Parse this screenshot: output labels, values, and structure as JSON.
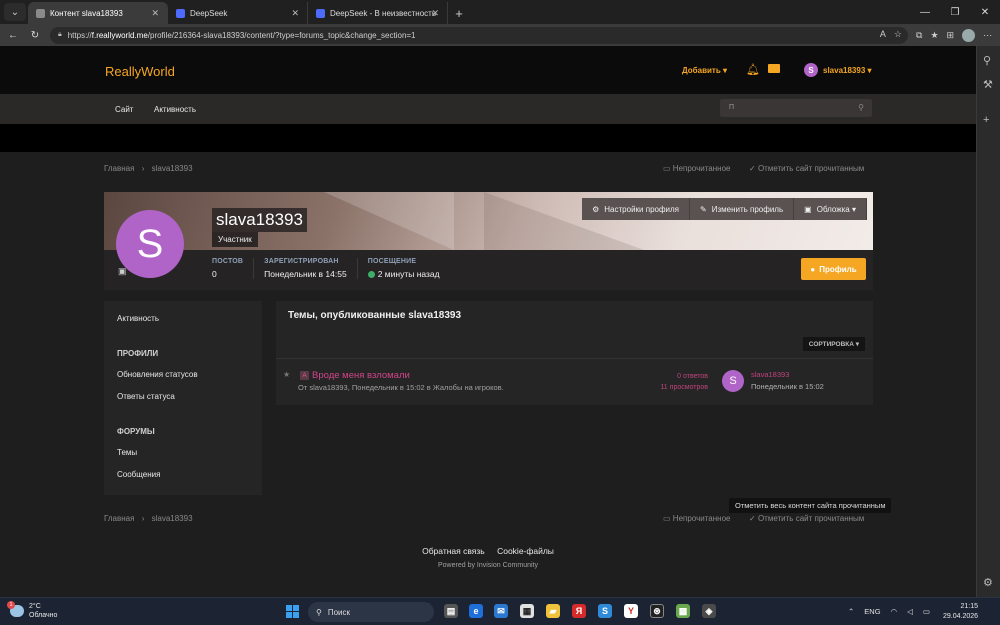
{
  "browser": {
    "tabs": [
      {
        "label": "Контент slava18393",
        "active": true
      },
      {
        "label": "DeepSeek",
        "active": false
      },
      {
        "label": "DeepSeek - В неизвестность",
        "active": false
      }
    ],
    "url_prefix": "https://",
    "url_host": "f.reallyworld.me",
    "url_path": "/profile/216364-slava18393/content/?type=forums_topic&change_section=1"
  },
  "site": {
    "logo": "ReallyWorld",
    "add_label": "Добавить ▾",
    "user_initial": "S",
    "user_name": "slava18393 ▾",
    "nav": [
      "Сайт",
      "Активность"
    ],
    "search_placeholder": "П"
  },
  "breadcrumb": {
    "home": "Главная",
    "sep": "›",
    "current": "slava18393",
    "unread": "Непрочитанное",
    "mark_read": "Отметить сайт прочитанным"
  },
  "profile": {
    "initial": "S",
    "name": "slava18393",
    "role": "Участник",
    "buttons": {
      "settings": "Настройки профиля",
      "edit": "Изменить профиль",
      "cover": "Обложка ▾"
    },
    "stats": {
      "posts_label": "ПОСТОВ",
      "posts_value": "0",
      "registered_label": "ЗАРЕГИСТРИРОВАН",
      "registered_value": "Понедельник в 14:55",
      "visit_label": "ПОСЕЩЕНИЕ",
      "visit_value": "2 минуты назад"
    },
    "profile_button": "Профиль"
  },
  "sidebar": {
    "activity": "Активность",
    "profiles_head": "ПРОФИЛИ",
    "status_updates": "Обновления статусов",
    "status_replies": "Ответы статуса",
    "forums_head": "ФОРУМЫ",
    "topics": "Темы",
    "messages": "Сообщения"
  },
  "main": {
    "title": "Темы, опубликованные slava18393",
    "sort": "СОРТИРОВКА ▾",
    "topic": {
      "badge": "A",
      "title": "Вроде меня взломали",
      "meta": "От slava18393, Понедельник в 15:02 в Жалобы на игроков.",
      "replies": "0 ответов",
      "views": "11 просмотров",
      "last_initial": "S",
      "last_user": "slava18393",
      "last_date": "Понедельник в 15:02"
    }
  },
  "tooltip": "Отметить весь контент сайта прочитанным",
  "footer": {
    "feedback": "Обратная связь",
    "cookies": "Cookie-файлы",
    "powered": "Powered by Invision Community"
  },
  "taskbar": {
    "weather_badge": "1",
    "temp": "2°C",
    "condition": "Облачно",
    "search": "Поиск",
    "lang": "ENG",
    "time": "21:15",
    "date": "29.04.2026"
  },
  "colors": {
    "accent": "#f5a623",
    "avatar": "#b064c8",
    "link_pink": "#d0448a",
    "online": "#3fae6b"
  }
}
